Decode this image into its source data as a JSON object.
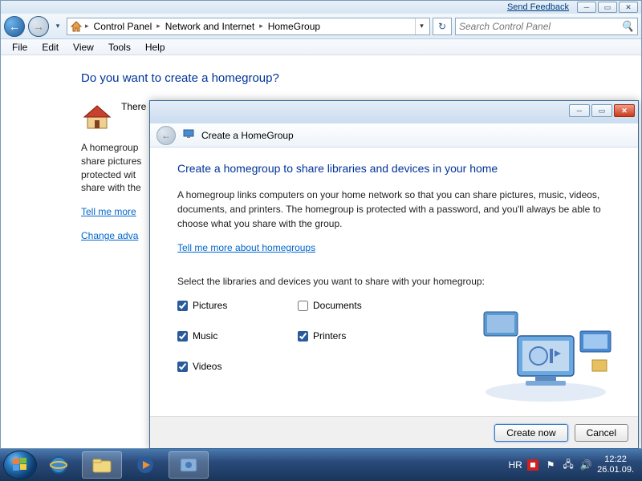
{
  "titlebar": {
    "feedback": "Send Feedback"
  },
  "breadcrumb": {
    "items": [
      "Control Panel",
      "Network and Internet",
      "HomeGroup"
    ]
  },
  "search": {
    "placeholder": "Search Control Panel"
  },
  "menubar": [
    "File",
    "Edit",
    "View",
    "Tools",
    "Help"
  ],
  "page": {
    "heading": "Do you want to create a homegroup?",
    "subheading": "There",
    "para": "A homegroup\nshare pictures\nprotected wit\nshare with the",
    "link1": "Tell me more",
    "link2": "Change adva"
  },
  "dialog": {
    "title": "Create a HomeGroup",
    "heading": "Create a homegroup to share libraries and devices in your home",
    "para": "A homegroup links computers on your home network so that you can share pictures, music, videos, documents, and printers. The homegroup is protected with a password, and you'll always be able to choose what you share with the group.",
    "link": "Tell me more about homegroups",
    "select_label": "Select the libraries and devices you want to share with your homegroup:",
    "options": {
      "pictures": "Pictures",
      "documents": "Documents",
      "music": "Music",
      "printers": "Printers",
      "videos": "Videos"
    },
    "checked": {
      "pictures": true,
      "documents": false,
      "music": true,
      "printers": true,
      "videos": true
    },
    "buttons": {
      "create": "Create now",
      "cancel": "Cancel"
    }
  },
  "tray": {
    "lang": "HR",
    "time": "12:22",
    "date": "26.01.09."
  }
}
